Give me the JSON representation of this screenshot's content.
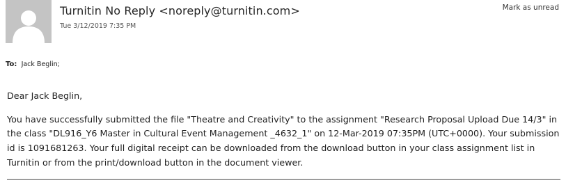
{
  "email": {
    "sender": "Turnitin No Reply <noreply@turnitin.com>",
    "datetime": "Tue 3/12/2019 7:35 PM",
    "mark_unread_label": "Mark as unread",
    "to_label": "To:",
    "to_recipient": "Jack Beglin;",
    "greeting": "Dear Jack Beglin,",
    "message": "You have successfully submitted the file \"Theatre and Creativity\" to the assignment \"Research Proposal Upload Due 14/3\" in the class \"DL916_Y6 Master in Cultural Event Management _4632_1\" on 12-Mar-2019 07:35PM (UTC+0000). Your submission id is 1091681263. Your full digital receipt can be downloaded from the download button in your class assignment list in Turnitin or from the print/download button in the document viewer."
  },
  "icons": {
    "avatar": "person-silhouette-icon"
  },
  "colors": {
    "avatar_bg": "#c4c4c4",
    "avatar_fg": "#ffffff"
  }
}
